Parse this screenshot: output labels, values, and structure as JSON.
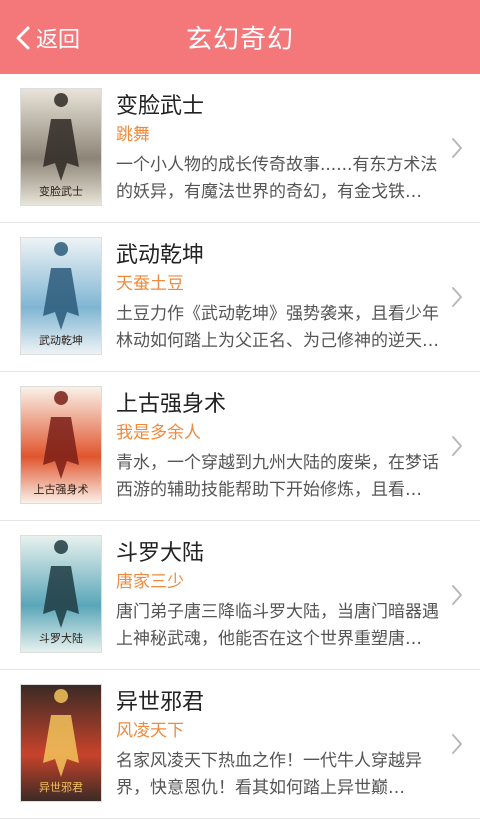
{
  "header": {
    "back_label": "返回",
    "title": "玄幻奇幻"
  },
  "books": [
    {
      "name": "变脸武士",
      "author": "跳舞",
      "description": "一个小人物的成长传奇故事......有东方术法的妖异，有魔法世界的奇幻，有金戈铁马……",
      "cover_text": "变脸武士",
      "cover_colors": [
        "#e9e4d9",
        "#8c8577",
        "#2e2a24"
      ]
    },
    {
      "name": "武动乾坤",
      "author": "天蚕土豆",
      "description": "土豆力作《武动乾坤》强势袭来，且看少年林动如何踏上为父正名、为己修神的逆天之路……",
      "cover_text": "武动乾坤",
      "cover_colors": [
        "#eef3f6",
        "#7fb5d2",
        "#2b5a7a"
      ]
    },
    {
      "name": "上古强身术",
      "author": "我是多余人",
      "description": "青水，一个穿越到九州大陆的废柴，在梦话西游的辅助技能帮助下开始修炼，且看他……",
      "cover_text": "上古强身术",
      "cover_colors": [
        "#faf1e8",
        "#e0552e",
        "#7a1f17"
      ]
    },
    {
      "name": "斗罗大陆",
      "author": "唐家三少",
      "description": "唐门弟子唐三降临斗罗大陆，当唐门暗器遇上神秘武魂，他能否在这个世界重塑唐门……",
      "cover_text": "斗罗大陆",
      "cover_colors": [
        "#e7f1ee",
        "#5aa6b8",
        "#1f3b42"
      ]
    },
    {
      "name": "异世邪君",
      "author": "风凌天下",
      "description": "名家风凌天下热血之作！一代牛人穿越异界，快意恩仇！看其如何踏上异世巅峰，……",
      "cover_text": "异世邪君",
      "cover_colors": [
        "#3a2b25",
        "#c8432b",
        "#f2c35b"
      ]
    }
  ]
}
